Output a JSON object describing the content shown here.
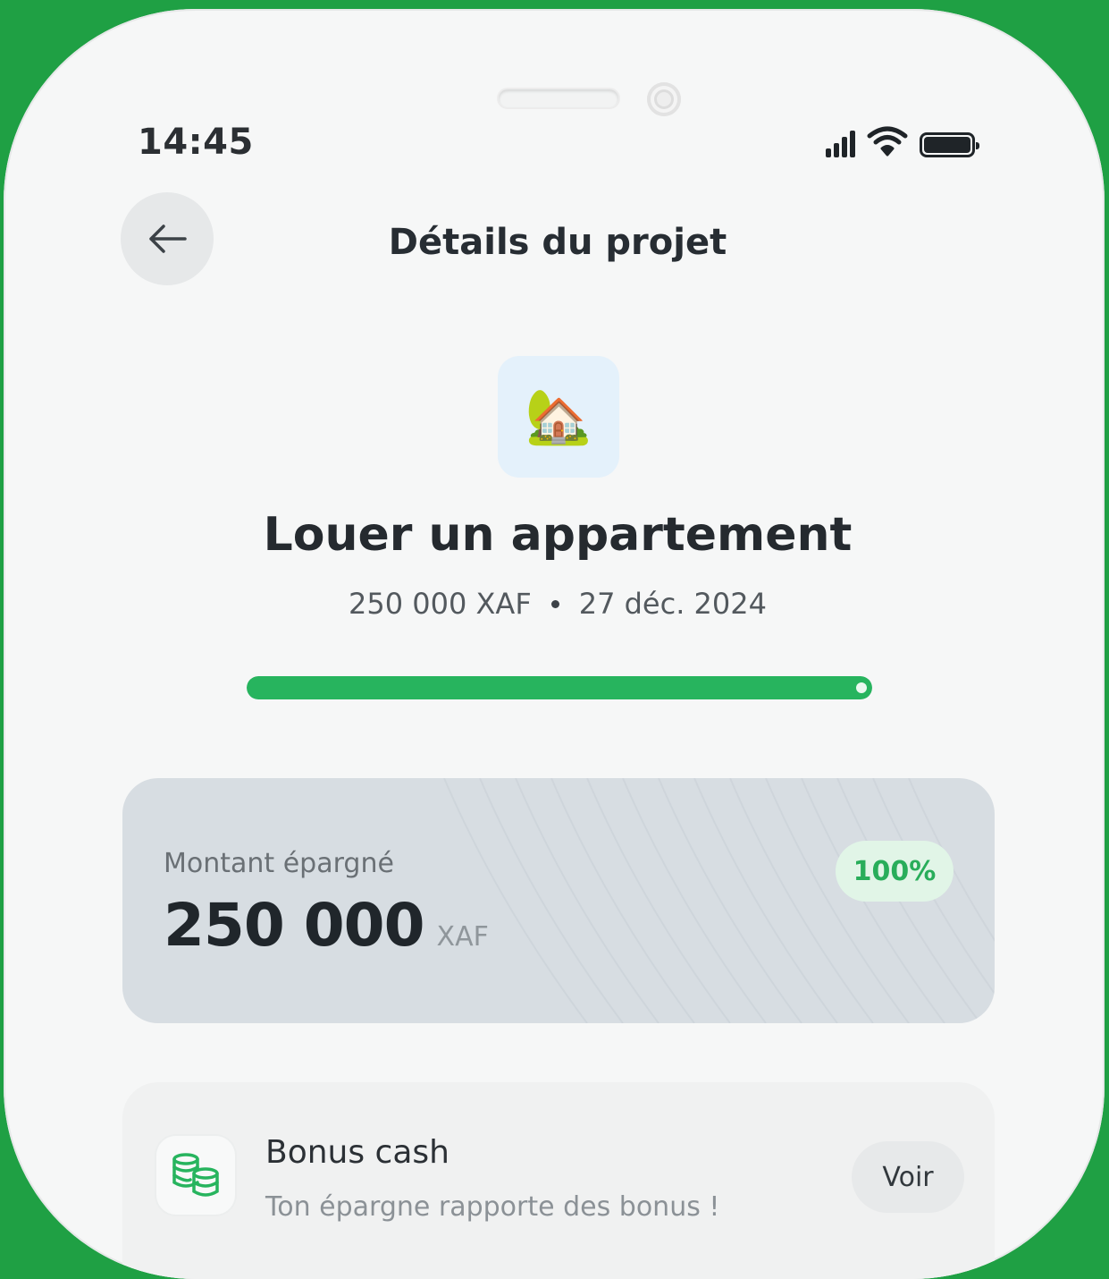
{
  "status_bar": {
    "time": "14:45",
    "icons": [
      "signal-icon",
      "wifi-icon",
      "battery-icon"
    ]
  },
  "header": {
    "back_icon": "arrow-left-icon",
    "title": "Détails du projet"
  },
  "project": {
    "icon": "house-with-garden-emoji",
    "icon_glyph": "🏡",
    "name": "Louer un appartement",
    "target_amount": "250 000 XAF",
    "target_date": "27 déc. 2024",
    "progress": 1.0
  },
  "savings": {
    "label": "Montant épargné",
    "amount": "250 000",
    "currency": "XAF",
    "percent": "100%"
  },
  "bonus": {
    "icon": "coins-stack-icon",
    "title": "Bonus cash",
    "subtitle": "Ton épargne rapporte des bonus !",
    "action_label": "Voir"
  },
  "colors": {
    "background_green": "#1fa044",
    "progress_green": "#27b45e",
    "badge_text_green": "#28ad5a",
    "badge_bg": "#e1f5e7",
    "card_bg": "#d7dde2",
    "icon_box_bg": "#e4f1fb"
  }
}
